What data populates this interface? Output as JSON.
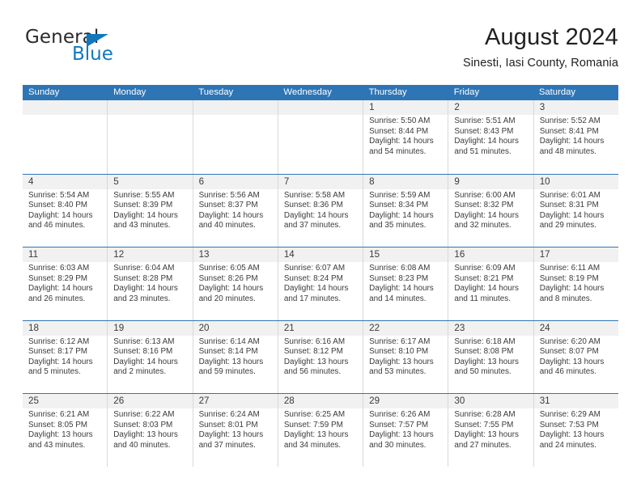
{
  "brand": {
    "name_dark": "General",
    "name_blue": "Blue",
    "color_blue": "#1278be"
  },
  "header": {
    "title": "August 2024",
    "subtitle": "Sinesti, Iasi County, Romania"
  },
  "theme": {
    "header_blue": "#2e75b6",
    "day_band_gray": "#f1f1f1",
    "text": "#3b3b3b"
  },
  "weekday_headers": [
    "Sunday",
    "Monday",
    "Tuesday",
    "Wednesday",
    "Thursday",
    "Friday",
    "Saturday"
  ],
  "weeks": [
    [
      {
        "day": "",
        "sunrise": "",
        "sunset": "",
        "daylight1": "",
        "daylight2": ""
      },
      {
        "day": "",
        "sunrise": "",
        "sunset": "",
        "daylight1": "",
        "daylight2": ""
      },
      {
        "day": "",
        "sunrise": "",
        "sunset": "",
        "daylight1": "",
        "daylight2": ""
      },
      {
        "day": "",
        "sunrise": "",
        "sunset": "",
        "daylight1": "",
        "daylight2": ""
      },
      {
        "day": "1",
        "sunrise": "Sunrise: 5:50 AM",
        "sunset": "Sunset: 8:44 PM",
        "daylight1": "Daylight: 14 hours",
        "daylight2": "and 54 minutes."
      },
      {
        "day": "2",
        "sunrise": "Sunrise: 5:51 AM",
        "sunset": "Sunset: 8:43 PM",
        "daylight1": "Daylight: 14 hours",
        "daylight2": "and 51 minutes."
      },
      {
        "day": "3",
        "sunrise": "Sunrise: 5:52 AM",
        "sunset": "Sunset: 8:41 PM",
        "daylight1": "Daylight: 14 hours",
        "daylight2": "and 48 minutes."
      }
    ],
    [
      {
        "day": "4",
        "sunrise": "Sunrise: 5:54 AM",
        "sunset": "Sunset: 8:40 PM",
        "daylight1": "Daylight: 14 hours",
        "daylight2": "and 46 minutes."
      },
      {
        "day": "5",
        "sunrise": "Sunrise: 5:55 AM",
        "sunset": "Sunset: 8:39 PM",
        "daylight1": "Daylight: 14 hours",
        "daylight2": "and 43 minutes."
      },
      {
        "day": "6",
        "sunrise": "Sunrise: 5:56 AM",
        "sunset": "Sunset: 8:37 PM",
        "daylight1": "Daylight: 14 hours",
        "daylight2": "and 40 minutes."
      },
      {
        "day": "7",
        "sunrise": "Sunrise: 5:58 AM",
        "sunset": "Sunset: 8:36 PM",
        "daylight1": "Daylight: 14 hours",
        "daylight2": "and 37 minutes."
      },
      {
        "day": "8",
        "sunrise": "Sunrise: 5:59 AM",
        "sunset": "Sunset: 8:34 PM",
        "daylight1": "Daylight: 14 hours",
        "daylight2": "and 35 minutes."
      },
      {
        "day": "9",
        "sunrise": "Sunrise: 6:00 AM",
        "sunset": "Sunset: 8:32 PM",
        "daylight1": "Daylight: 14 hours",
        "daylight2": "and 32 minutes."
      },
      {
        "day": "10",
        "sunrise": "Sunrise: 6:01 AM",
        "sunset": "Sunset: 8:31 PM",
        "daylight1": "Daylight: 14 hours",
        "daylight2": "and 29 minutes."
      }
    ],
    [
      {
        "day": "11",
        "sunrise": "Sunrise: 6:03 AM",
        "sunset": "Sunset: 8:29 PM",
        "daylight1": "Daylight: 14 hours",
        "daylight2": "and 26 minutes."
      },
      {
        "day": "12",
        "sunrise": "Sunrise: 6:04 AM",
        "sunset": "Sunset: 8:28 PM",
        "daylight1": "Daylight: 14 hours",
        "daylight2": "and 23 minutes."
      },
      {
        "day": "13",
        "sunrise": "Sunrise: 6:05 AM",
        "sunset": "Sunset: 8:26 PM",
        "daylight1": "Daylight: 14 hours",
        "daylight2": "and 20 minutes."
      },
      {
        "day": "14",
        "sunrise": "Sunrise: 6:07 AM",
        "sunset": "Sunset: 8:24 PM",
        "daylight1": "Daylight: 14 hours",
        "daylight2": "and 17 minutes."
      },
      {
        "day": "15",
        "sunrise": "Sunrise: 6:08 AM",
        "sunset": "Sunset: 8:23 PM",
        "daylight1": "Daylight: 14 hours",
        "daylight2": "and 14 minutes."
      },
      {
        "day": "16",
        "sunrise": "Sunrise: 6:09 AM",
        "sunset": "Sunset: 8:21 PM",
        "daylight1": "Daylight: 14 hours",
        "daylight2": "and 11 minutes."
      },
      {
        "day": "17",
        "sunrise": "Sunrise: 6:11 AM",
        "sunset": "Sunset: 8:19 PM",
        "daylight1": "Daylight: 14 hours",
        "daylight2": "and 8 minutes."
      }
    ],
    [
      {
        "day": "18",
        "sunrise": "Sunrise: 6:12 AM",
        "sunset": "Sunset: 8:17 PM",
        "daylight1": "Daylight: 14 hours",
        "daylight2": "and 5 minutes."
      },
      {
        "day": "19",
        "sunrise": "Sunrise: 6:13 AM",
        "sunset": "Sunset: 8:16 PM",
        "daylight1": "Daylight: 14 hours",
        "daylight2": "and 2 minutes."
      },
      {
        "day": "20",
        "sunrise": "Sunrise: 6:14 AM",
        "sunset": "Sunset: 8:14 PM",
        "daylight1": "Daylight: 13 hours",
        "daylight2": "and 59 minutes."
      },
      {
        "day": "21",
        "sunrise": "Sunrise: 6:16 AM",
        "sunset": "Sunset: 8:12 PM",
        "daylight1": "Daylight: 13 hours",
        "daylight2": "and 56 minutes."
      },
      {
        "day": "22",
        "sunrise": "Sunrise: 6:17 AM",
        "sunset": "Sunset: 8:10 PM",
        "daylight1": "Daylight: 13 hours",
        "daylight2": "and 53 minutes."
      },
      {
        "day": "23",
        "sunrise": "Sunrise: 6:18 AM",
        "sunset": "Sunset: 8:08 PM",
        "daylight1": "Daylight: 13 hours",
        "daylight2": "and 50 minutes."
      },
      {
        "day": "24",
        "sunrise": "Sunrise: 6:20 AM",
        "sunset": "Sunset: 8:07 PM",
        "daylight1": "Daylight: 13 hours",
        "daylight2": "and 46 minutes."
      }
    ],
    [
      {
        "day": "25",
        "sunrise": "Sunrise: 6:21 AM",
        "sunset": "Sunset: 8:05 PM",
        "daylight1": "Daylight: 13 hours",
        "daylight2": "and 43 minutes."
      },
      {
        "day": "26",
        "sunrise": "Sunrise: 6:22 AM",
        "sunset": "Sunset: 8:03 PM",
        "daylight1": "Daylight: 13 hours",
        "daylight2": "and 40 minutes."
      },
      {
        "day": "27",
        "sunrise": "Sunrise: 6:24 AM",
        "sunset": "Sunset: 8:01 PM",
        "daylight1": "Daylight: 13 hours",
        "daylight2": "and 37 minutes."
      },
      {
        "day": "28",
        "sunrise": "Sunrise: 6:25 AM",
        "sunset": "Sunset: 7:59 PM",
        "daylight1": "Daylight: 13 hours",
        "daylight2": "and 34 minutes."
      },
      {
        "day": "29",
        "sunrise": "Sunrise: 6:26 AM",
        "sunset": "Sunset: 7:57 PM",
        "daylight1": "Daylight: 13 hours",
        "daylight2": "and 30 minutes."
      },
      {
        "day": "30",
        "sunrise": "Sunrise: 6:28 AM",
        "sunset": "Sunset: 7:55 PM",
        "daylight1": "Daylight: 13 hours",
        "daylight2": "and 27 minutes."
      },
      {
        "day": "31",
        "sunrise": "Sunrise: 6:29 AM",
        "sunset": "Sunset: 7:53 PM",
        "daylight1": "Daylight: 13 hours",
        "daylight2": "and 24 minutes."
      }
    ]
  ]
}
